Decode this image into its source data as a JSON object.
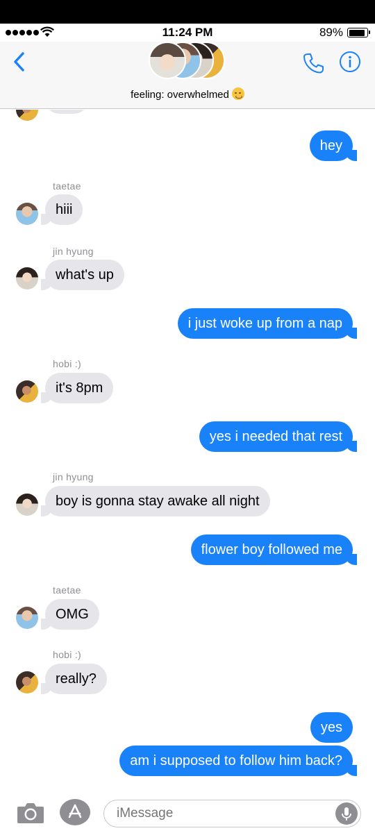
{
  "status_bar": {
    "time": "11:24 PM",
    "battery_percent": "89%",
    "battery_level": 0.89,
    "signal_bars": 5,
    "wifi_icon": "wifi-icon"
  },
  "header": {
    "back_icon": "chevron-left-icon",
    "group_name": "feeling: overwhelmed",
    "group_emoji": "woozy-face-emoji",
    "call_icon": "phone-icon",
    "info_icon": "info-icon",
    "accent_color": "#1a82f8"
  },
  "messages": [
    {
      "from": "me",
      "text": "hey"
    },
    {
      "from": "taetae",
      "text": "hiii"
    },
    {
      "from": "jin hyung",
      "text": "what's up"
    },
    {
      "from": "me",
      "text": "i just woke up from a nap"
    },
    {
      "from": "hobi :)",
      "text": "it's 8pm"
    },
    {
      "from": "me",
      "text": "yes i needed that rest"
    },
    {
      "from": "jin hyung",
      "text": "boy is gonna stay awake all night"
    },
    {
      "from": "me",
      "text": "flower boy followed me"
    },
    {
      "from": "taetae",
      "text": "OMG"
    },
    {
      "from": "hobi :)",
      "text": "really?"
    },
    {
      "from": "me",
      "text": "yes"
    },
    {
      "from": "me",
      "text": "am i supposed to follow him back?"
    }
  ],
  "input_bar": {
    "placeholder": "iMessage",
    "camera_icon": "camera-icon",
    "apps_icon": "app-store-icon",
    "mic_icon": "microphone-icon"
  },
  "colors": {
    "outgoing_bubble": "#1a82f8",
    "incoming_bubble": "#e5e5ea",
    "sender_name": "#8e8e93"
  }
}
